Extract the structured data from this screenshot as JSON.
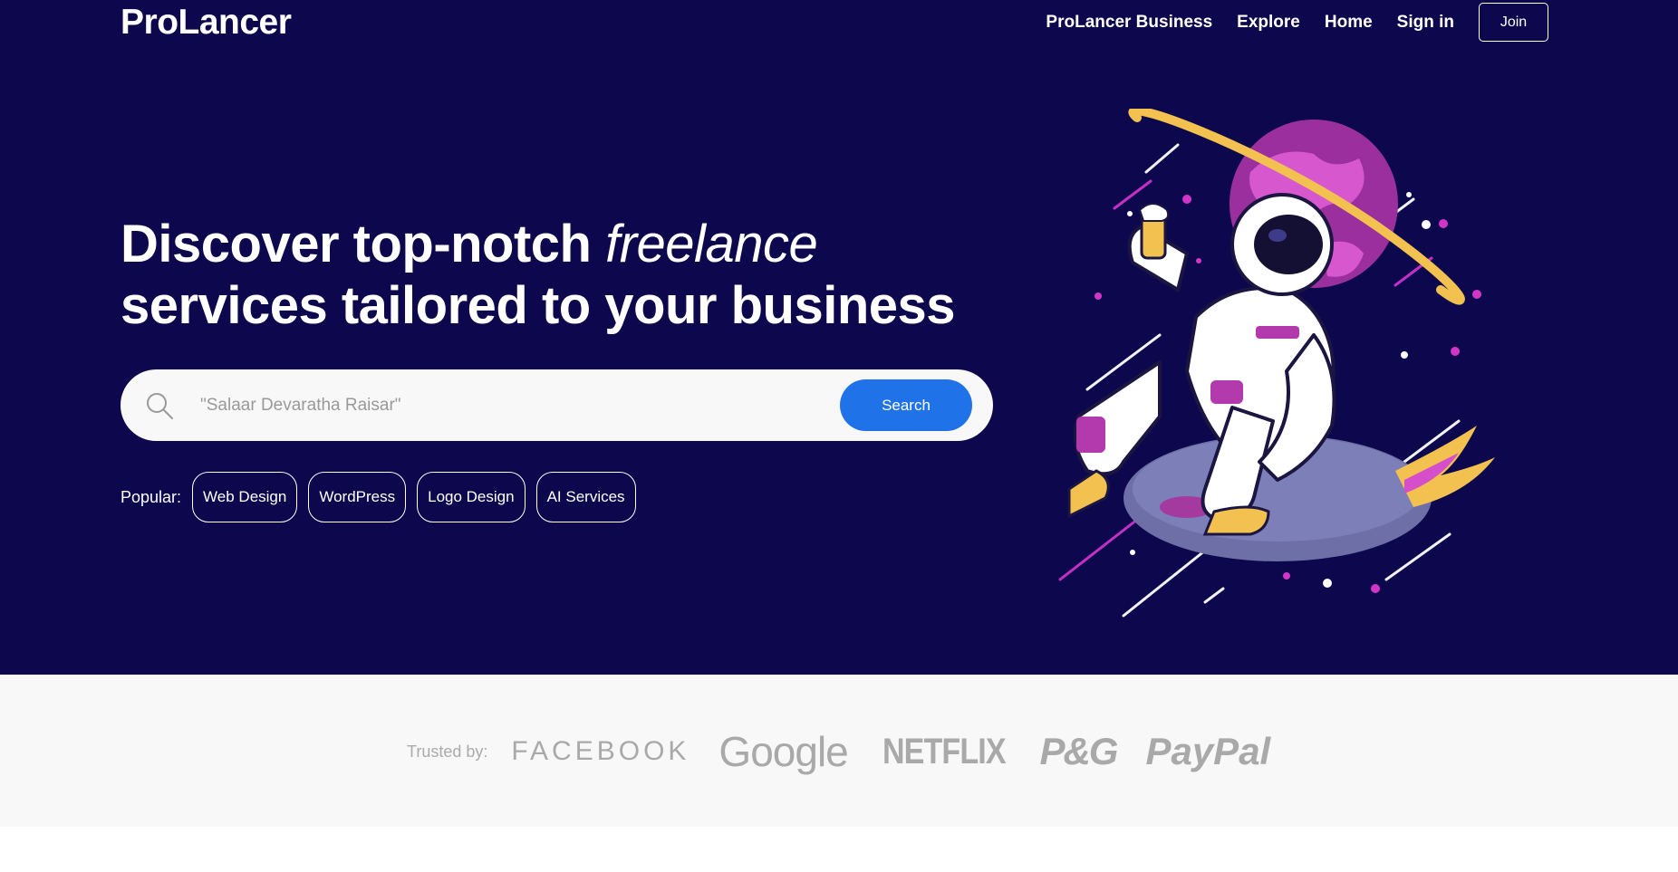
{
  "header": {
    "logo": "ProLancer",
    "nav": [
      "ProLancer Business",
      "Explore",
      "Home",
      "Sign in"
    ],
    "join_label": "Join"
  },
  "hero": {
    "headline_part1": "Discover top-notch ",
    "headline_em": "freelance",
    "headline_part2": "services tailored to your business",
    "illustration_icon": "astronaut-on-rocket-illustration"
  },
  "search": {
    "placeholder": "\"Salaar Devaratha Raisar\"",
    "button_label": "Search",
    "icon": "search-icon"
  },
  "popular": {
    "label": "Popular:",
    "tags": [
      "Web Design",
      "WordPress",
      "Logo Design",
      "AI Services"
    ]
  },
  "trusted": {
    "label": "Trusted by:",
    "brands": [
      "FACEBOOK",
      "Google",
      "NETFLIX",
      "P&G",
      "PayPal"
    ]
  },
  "colors": {
    "hero_bg": "#0d084d",
    "accent": "#1f72e8",
    "trusted_bg": "#f8f8f8"
  }
}
